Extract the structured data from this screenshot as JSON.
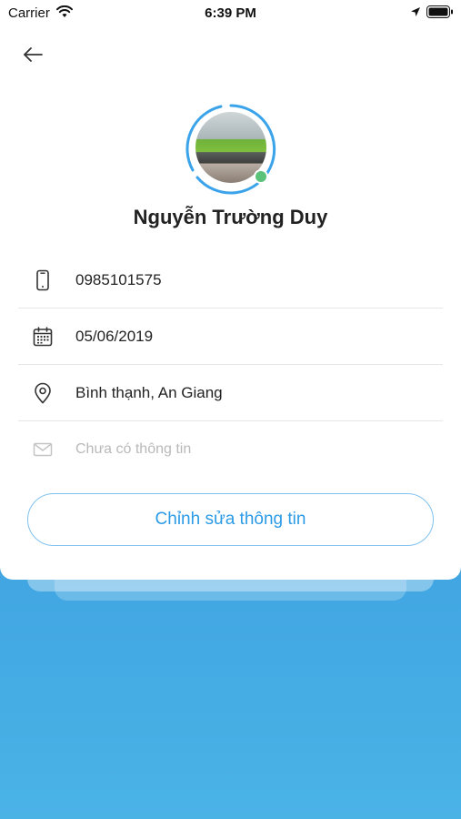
{
  "status_bar": {
    "carrier": "Carrier",
    "time": "6:39 PM"
  },
  "profile": {
    "name": "Nguyễn Trường Duy",
    "online": true
  },
  "info": {
    "phone": "0985101575",
    "birthday": "05/06/2019",
    "address": "Bình thạnh, An Giang",
    "email_placeholder": "Chưa có thông tin"
  },
  "actions": {
    "edit_label": "Chỉnh sửa thông tin"
  },
  "colors": {
    "accent": "#2c9be6",
    "ring": "#3aa3ea",
    "online": "#5bc27a",
    "background_gradient_top": "#3a8fd9",
    "background_gradient_bottom": "#4ab3e6"
  }
}
